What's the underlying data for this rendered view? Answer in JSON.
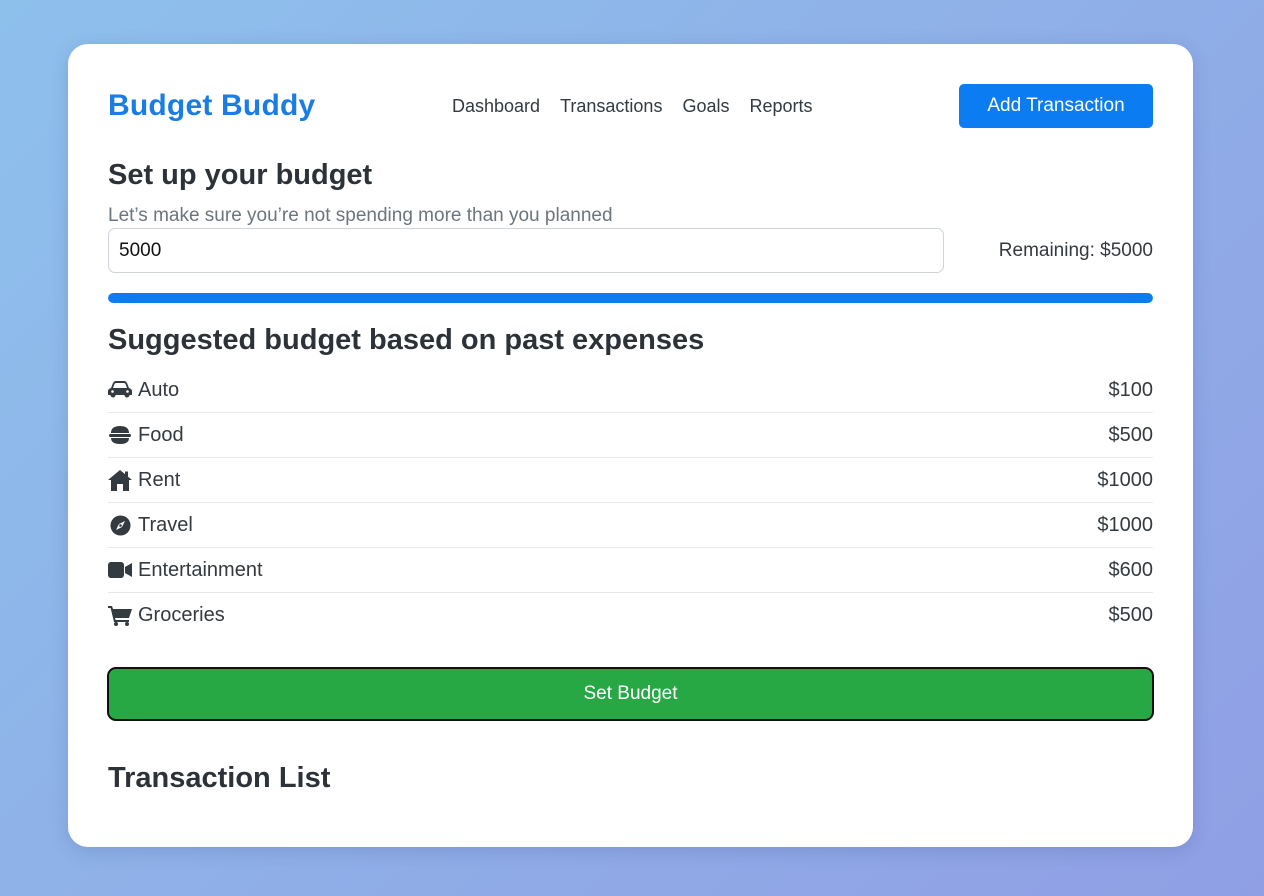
{
  "header": {
    "brand": "Budget Buddy",
    "nav": [
      "Dashboard",
      "Transactions",
      "Goals",
      "Reports"
    ],
    "add_button": "Add Transaction"
  },
  "setup": {
    "title": "Set up your budget",
    "subtitle": "Let’s make sure you’re not spending more than you planned",
    "input_value": "5000",
    "remaining": "Remaining: $5000",
    "progress_fraction": 1.0
  },
  "suggested": {
    "title": "Suggested budget based on past expenses",
    "categories": [
      {
        "icon": "car-icon",
        "label": "Auto",
        "amount": "$100"
      },
      {
        "icon": "food-bowl-icon",
        "label": "Food",
        "amount": "$500"
      },
      {
        "icon": "home-icon",
        "label": "Rent",
        "amount": "$1000"
      },
      {
        "icon": "compass-icon",
        "label": "Travel",
        "amount": "$1000"
      },
      {
        "icon": "video-camera-icon",
        "label": "Entertainment",
        "amount": "$600"
      },
      {
        "icon": "shopping-cart-icon",
        "label": "Groceries",
        "amount": "$500"
      }
    ]
  },
  "set_budget_button": "Set Budget",
  "transactions": {
    "title": "Transaction List"
  },
  "colors": {
    "brand": "#1a7de6",
    "primary": "#0b7cf2",
    "success": "#28a745"
  }
}
